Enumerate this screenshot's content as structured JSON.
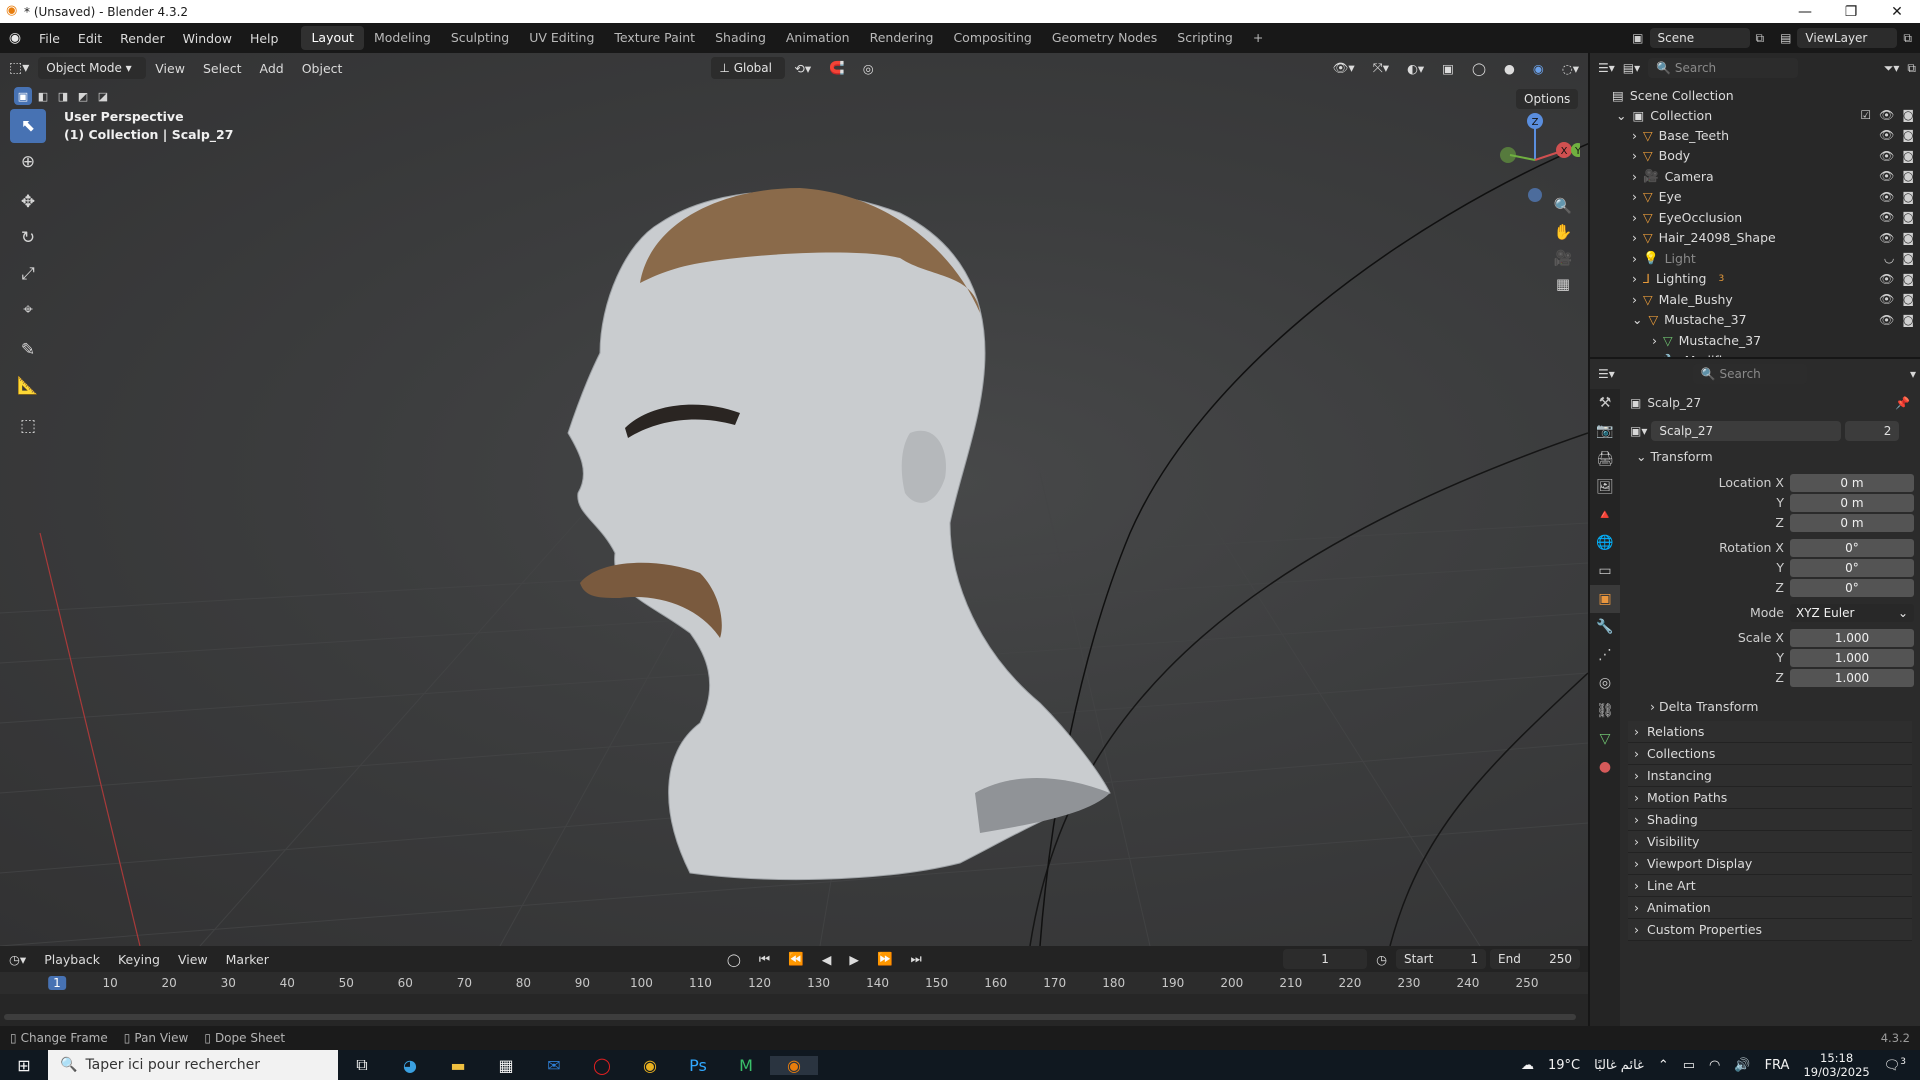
{
  "window": {
    "title": "* (Unsaved) - Blender 4.3.2",
    "minimize": "—",
    "maximize": "❐",
    "close": "✕"
  },
  "menu": {
    "items": [
      "File",
      "Edit",
      "Render",
      "Window",
      "Help"
    ],
    "workspaces": [
      "Layout",
      "Modeling",
      "Sculpting",
      "UV Editing",
      "Texture Paint",
      "Shading",
      "Animation",
      "Rendering",
      "Compositing",
      "Geometry Nodes",
      "Scripting"
    ],
    "active_workspace": "Layout",
    "add_workspace": "+",
    "scene": "Scene",
    "view_layer": "ViewLayer"
  },
  "viewport": {
    "mode": "Object Mode",
    "menus": [
      "View",
      "Select",
      "Add",
      "Object"
    ],
    "orientation": "Global",
    "options": "Options",
    "perspective": "User Perspective",
    "collection_info": "(1) Collection | Scalp_27",
    "gizmo_axes": [
      "Z",
      "X",
      "Y"
    ]
  },
  "outliner": {
    "search_placeholder": "Search",
    "scene_collection": "Scene Collection",
    "collection": "Collection",
    "items": [
      {
        "name": "Base_Teeth",
        "icon": "mesh-icon"
      },
      {
        "name": "Body",
        "icon": "mesh-icon"
      },
      {
        "name": "Camera",
        "icon": "camera-icon"
      },
      {
        "name": "Eye",
        "icon": "mesh-icon"
      },
      {
        "name": "EyeOcclusion",
        "icon": "mesh-icon"
      },
      {
        "name": "Hair_24098_Shape",
        "icon": "mesh-icon"
      },
      {
        "name": "Light",
        "icon": "light-icon"
      },
      {
        "name": "Lighting",
        "icon": "empty-icon"
      },
      {
        "name": "Male_Bushy",
        "icon": "mesh-icon"
      },
      {
        "name": "Mustache_37",
        "icon": "mesh-icon"
      }
    ],
    "children": [
      {
        "name": "Mustache_37",
        "icon": "mesh-data-icon"
      },
      {
        "name": "Modifiers",
        "icon": "wrench-icon"
      }
    ],
    "lighting_badge": "3"
  },
  "properties": {
    "search_placeholder": "Search",
    "object_name": "Scalp_27",
    "data_name": "Scalp_27",
    "users": "2",
    "transform_label": "Transform",
    "location_label": "Location X",
    "location": [
      "0 m",
      "0 m",
      "0 m"
    ],
    "rotation_label": "Rotation X",
    "rotation": [
      "0°",
      "0°",
      "0°"
    ],
    "mode_label": "Mode",
    "mode_value": "XYZ Euler",
    "scale_label": "Scale X",
    "scale": [
      "1.000",
      "1.000",
      "1.000"
    ],
    "axis_y": "Y",
    "axis_z": "Z",
    "delta_transform": "Delta Transform",
    "panels": [
      "Relations",
      "Collections",
      "Instancing",
      "Motion Paths",
      "Shading",
      "Visibility",
      "Viewport Display",
      "Line Art",
      "Animation",
      "Custom Properties"
    ]
  },
  "timeline": {
    "menus": [
      "Playback",
      "Keying",
      "View",
      "Marker"
    ],
    "current_frame": "1",
    "start_label": "Start",
    "start": "1",
    "end_label": "End",
    "end": "250",
    "ticks": [
      "1",
      "10",
      "20",
      "30",
      "40",
      "50",
      "60",
      "70",
      "80",
      "90",
      "100",
      "110",
      "120",
      "130",
      "140",
      "150",
      "160",
      "170",
      "180",
      "190",
      "200",
      "210",
      "220",
      "230",
      "240",
      "250"
    ]
  },
  "statusbar": {
    "hints": [
      "Change Frame",
      "Pan View",
      "Dope Sheet"
    ],
    "version": "4.3.2"
  },
  "taskbar": {
    "search_placeholder": "Taper ici pour rechercher",
    "temperature": "19°C",
    "weather_text": "غائم غالبًا",
    "language": "FRA",
    "time": "15:18",
    "date": "19/03/2025",
    "notifications": "3"
  }
}
